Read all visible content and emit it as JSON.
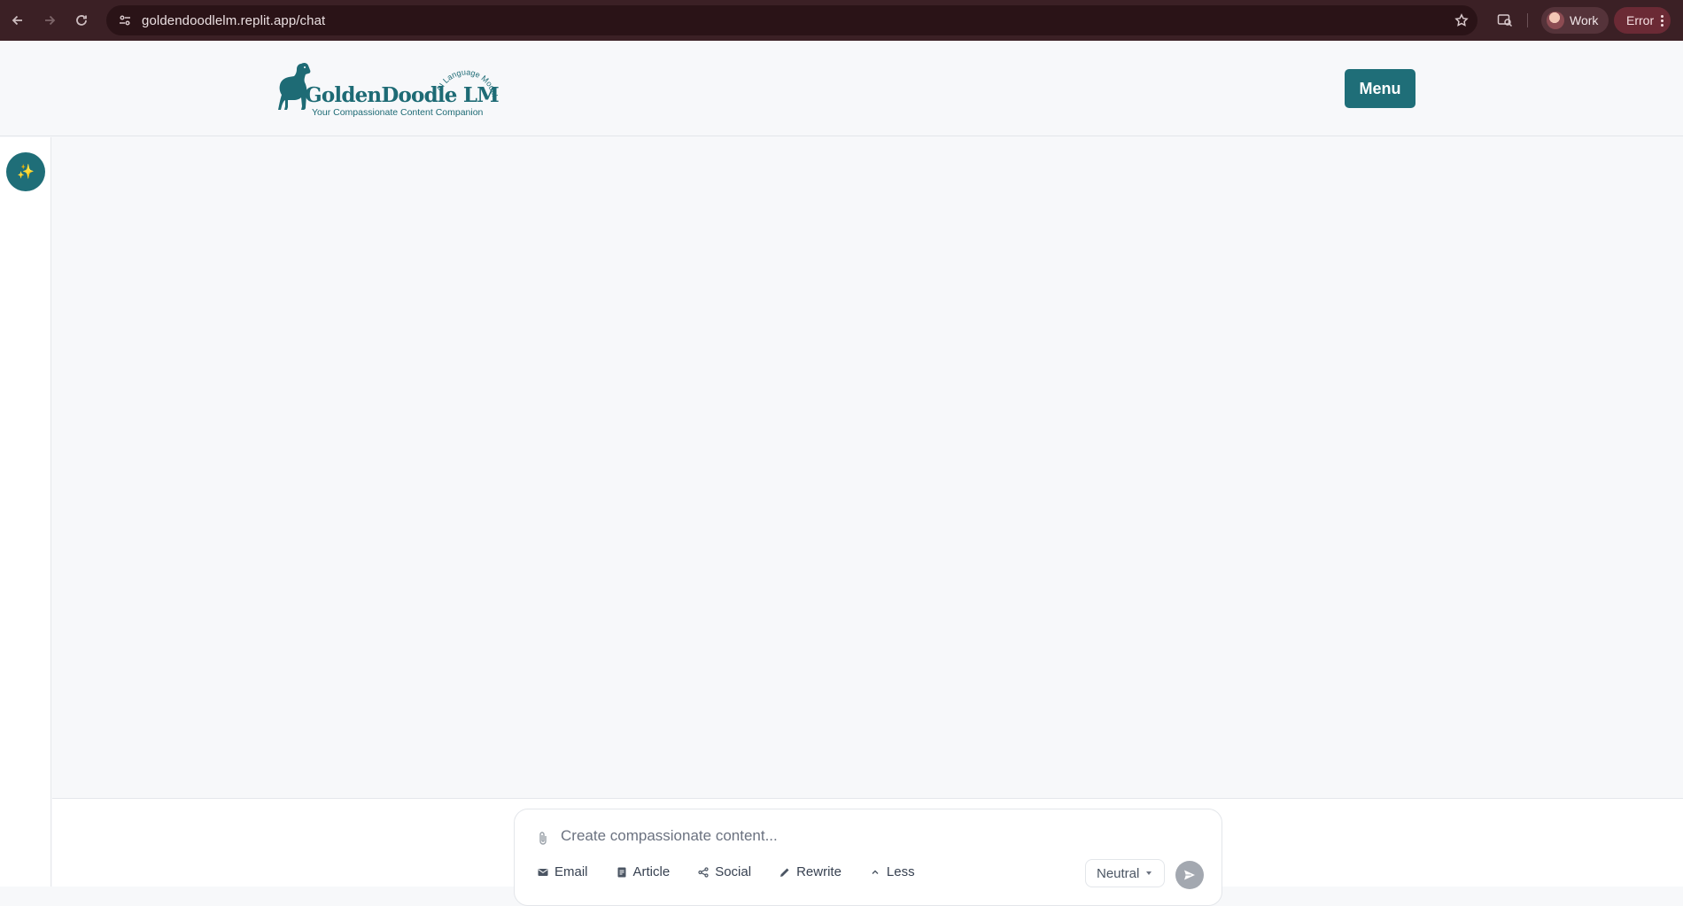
{
  "browser": {
    "url": "goldendoodlelm.replit.app/chat",
    "profile_label": "Work",
    "error_label": "Error",
    "icons": [
      "back-arrow-icon",
      "forward-arrow-icon",
      "reload-icon",
      "site-info-icon",
      "bookmark-star-icon",
      "lens-icon",
      "more-vert-icon"
    ]
  },
  "header": {
    "logo_wordmark": "GoldenDoodle LM",
    "logo_tagline": "Your Compassionate Content Companion",
    "logo_arc_text": "AI Language Model",
    "menu_label": "Menu"
  },
  "sidebar": {
    "sparkle_icon": "✨"
  },
  "composer": {
    "placeholder": "Create compassionate content...",
    "actions": [
      {
        "label": "Email",
        "icon": "mail-icon"
      },
      {
        "label": "Article",
        "icon": "document-icon"
      },
      {
        "label": "Social",
        "icon": "share-icon"
      },
      {
        "label": "Rewrite",
        "icon": "pencil-icon"
      },
      {
        "label": "Less",
        "icon": "chevron-up-icon"
      }
    ],
    "tone": "Neutral"
  },
  "colors": {
    "brand": "#1f6e78",
    "chrome_bg": "#3b2025",
    "send_disabled": "#a3a8b0"
  }
}
